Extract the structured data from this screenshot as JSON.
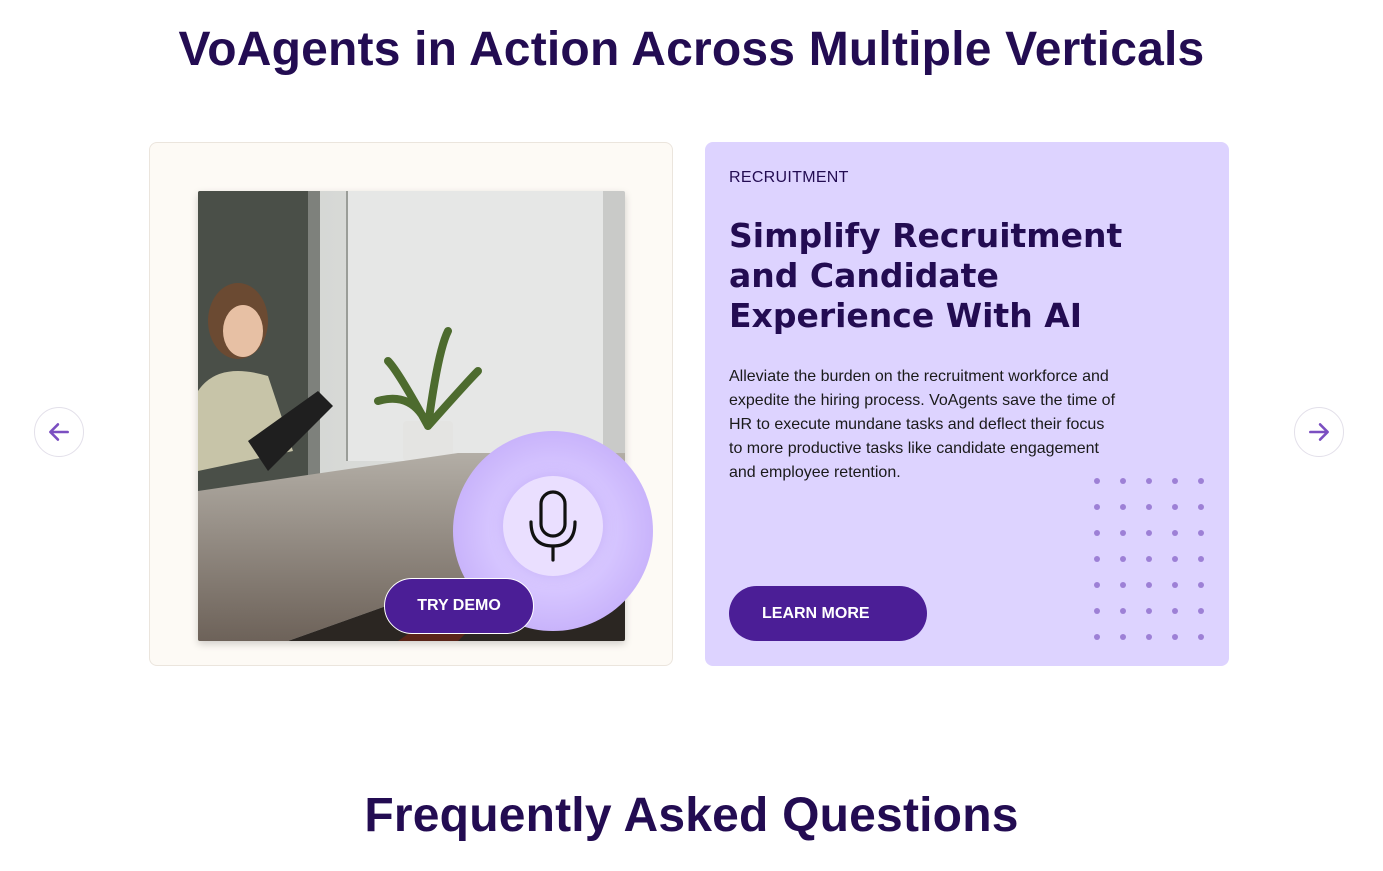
{
  "section": {
    "title": "VoAgents in Action Across Multiple Verticals"
  },
  "carousel": {
    "prev_icon": "arrow-left-icon",
    "next_icon": "arrow-right-icon",
    "accent_color": "#7b4fc1",
    "demo": {
      "button_label": "TRY DEMO",
      "mic_icon": "microphone-icon"
    },
    "slide": {
      "eyebrow": "RECRUITMENT",
      "heading": "Simplify Recruitment and Candidate Experience With AI",
      "body": "Alleviate the burden on the recruitment workforce and expedite the hiring process. VoAgents save the time of HR to execute mundane tasks and deflect their focus to more productive tasks like candidate engagement and employee retention.",
      "button_label": "LEARN MORE",
      "background_color": "#ddd3ff",
      "button_color": "#4b1e96"
    }
  },
  "faq": {
    "title": "Frequently Asked Questions"
  }
}
